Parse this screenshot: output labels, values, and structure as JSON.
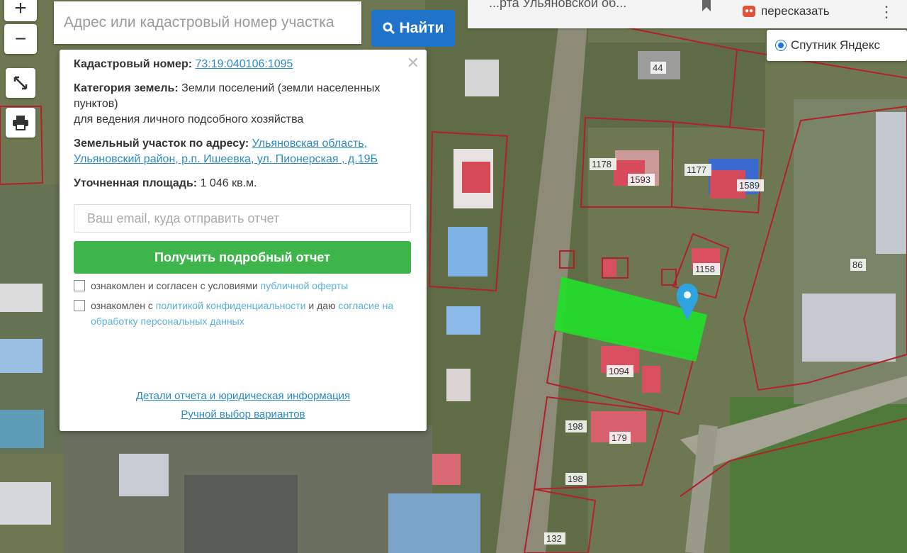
{
  "search": {
    "placeholder": "Адрес или кадастровый номер участка",
    "button_label": "Найти"
  },
  "map_controls": {
    "zoom_in": "+",
    "zoom_out": "−"
  },
  "top_bar": {
    "title": "...рта Ульяновской об...",
    "retell_label": "пересказать"
  },
  "layer": {
    "label": "Спутник Яндекс"
  },
  "popup": {
    "cadastral_label": "Кадастровый номер:",
    "cadastral_value": "73:19:040106:1095",
    "category_label": "Категория земель:",
    "category_value": "Земли поселений (земли населенных пунктов)",
    "usage": "для ведения личного подсобного хозяйства",
    "address_label": "Земельный участок по адресу:",
    "address_value": "Ульяновская область, Ульяновский район, р.п. Ишеевка, ул. Пионерская , д.19Б",
    "area_label": "Уточненная площадь:",
    "area_value": "1 046 кв.м.",
    "email_placeholder": "Ваш email, куда отправить отчет",
    "report_button": "Получить подробный отчет",
    "consent1_text": "ознакомлен и согласен с условиями",
    "consent1_link": "публичной оферты",
    "consent2_text_a": "ознакомлен с",
    "consent2_link1": "политикой конфиденциальности",
    "consent2_text_b": "и даю",
    "consent2_link2": "согласие на обработку персональных данных",
    "details_link": "Детали отчета и юридическая информация",
    "manual_link": "Ручной выбор вариантов"
  },
  "parcel_labels": [
    "44",
    "1178",
    "1593",
    "1177",
    "1589",
    "1158",
    "86",
    "1094",
    "198",
    "179",
    "198",
    "132"
  ],
  "colors": {
    "parcel_border": "#b3202a",
    "selected_parcel": "#22e02a",
    "marker": "#2ea3e0",
    "accent": "#1f73c9"
  }
}
